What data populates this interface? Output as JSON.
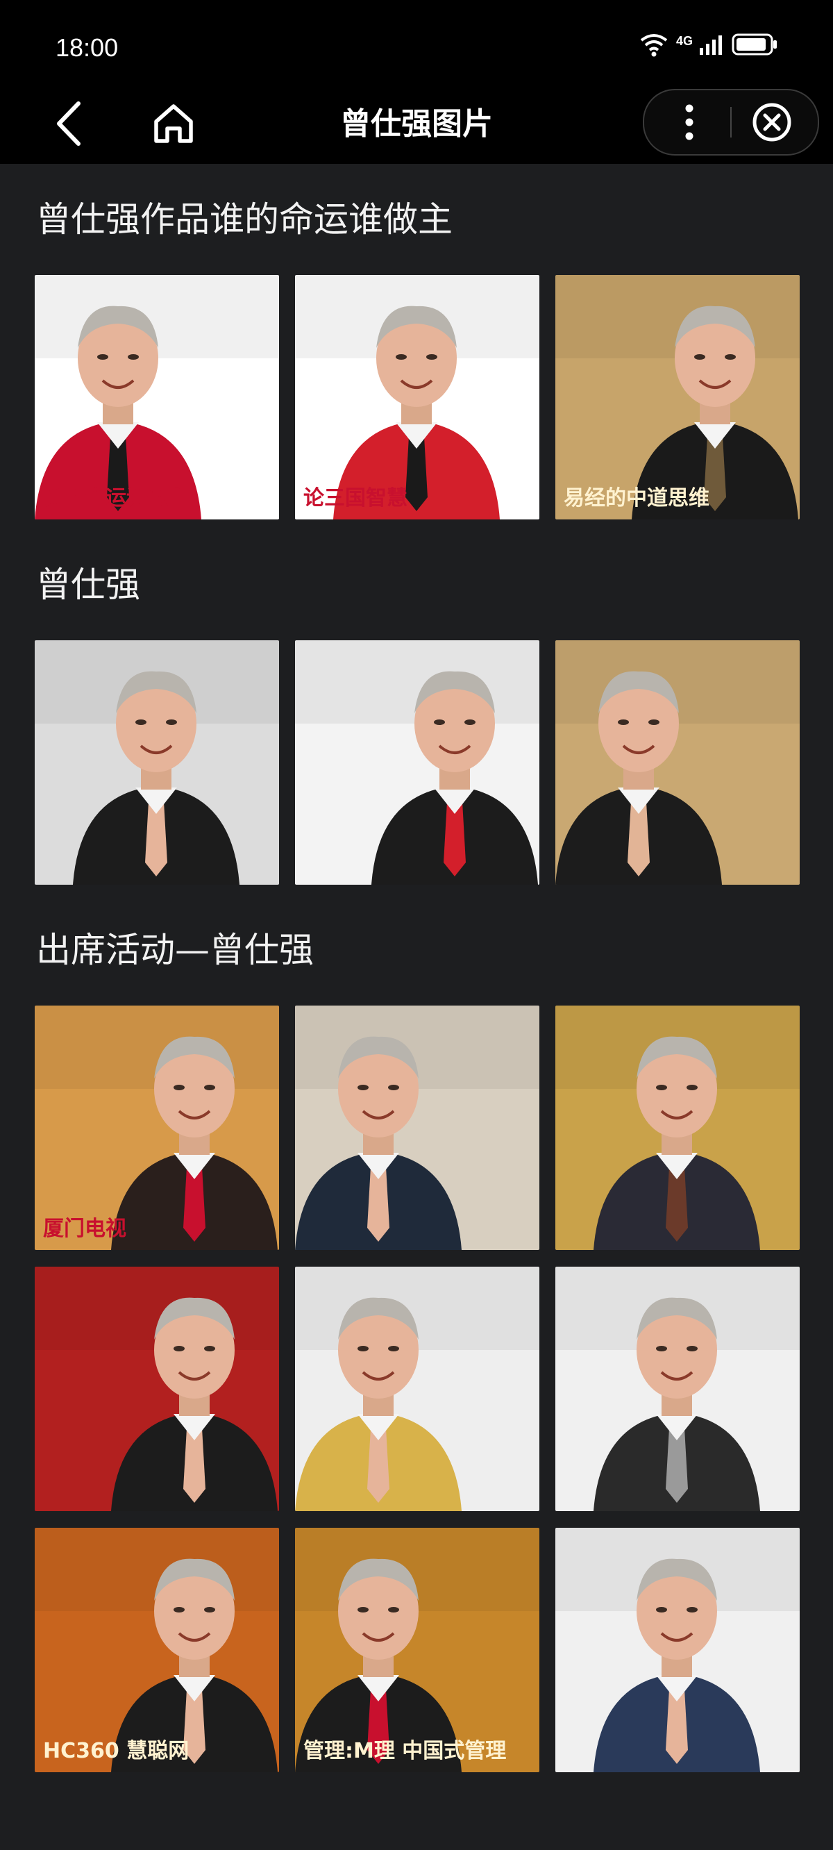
{
  "status_bar": {
    "time": "18:00",
    "network": "4G"
  },
  "nav": {
    "title": "曾仕强图片"
  },
  "sections": [
    {
      "title": "曾仕强作品谁的命运谁做主",
      "images": [
        {
          "caption": "谁的命运谁做主!",
          "theme": [
            "#ffffff",
            "#c8102e",
            "#1a1a1a"
          ]
        },
        {
          "caption": "论三国智慧",
          "theme": [
            "#ffffff",
            "#d31f2b",
            "#1a1a1a"
          ]
        },
        {
          "caption": "易经的中道思维",
          "theme": [
            "#c7a46a",
            "#1a1a1a",
            "#6f5a3a"
          ]
        }
      ]
    },
    {
      "title": "曾仕强",
      "images": [
        {
          "theme": [
            "#dcdcdc",
            "#1c1c1c",
            "#e6b49a"
          ]
        },
        {
          "theme": [
            "#f3f3f3",
            "#1c1c1c",
            "#d31f2b"
          ]
        },
        {
          "theme": [
            "#c9a872",
            "#1c1c1c",
            "#e2b496"
          ]
        }
      ]
    },
    {
      "title": "出席活动—曾仕强",
      "images": [
        {
          "caption": "厦门电视",
          "theme": [
            "#d79a4a",
            "#2a1f1c",
            "#c8102e"
          ]
        },
        {
          "theme": [
            "#d8cfc0",
            "#1f2a3a",
            "#e6b49a"
          ]
        },
        {
          "theme": [
            "#c9a24a",
            "#2a2a35",
            "#6b3a2a"
          ]
        },
        {
          "theme": [
            "#b2201f",
            "#1c1c1c",
            "#e6b49a"
          ]
        },
        {
          "theme": [
            "#eeeeee",
            "#d8b24a",
            "#e6b49a"
          ]
        },
        {
          "theme": [
            "#f0f0f0",
            "#2a2a2a",
            "#9a9a9a"
          ]
        },
        {
          "caption": "HC360 慧聪网",
          "theme": [
            "#c8641e",
            "#1c1c1c",
            "#e6b49a"
          ]
        },
        {
          "caption": "管理:M理 中国式管理",
          "theme": [
            "#c6862a",
            "#1c1c1c",
            "#c8102e"
          ]
        },
        {
          "theme": [
            "#f0f0f0",
            "#2a3a5a",
            "#e6b49a"
          ]
        }
      ]
    }
  ]
}
